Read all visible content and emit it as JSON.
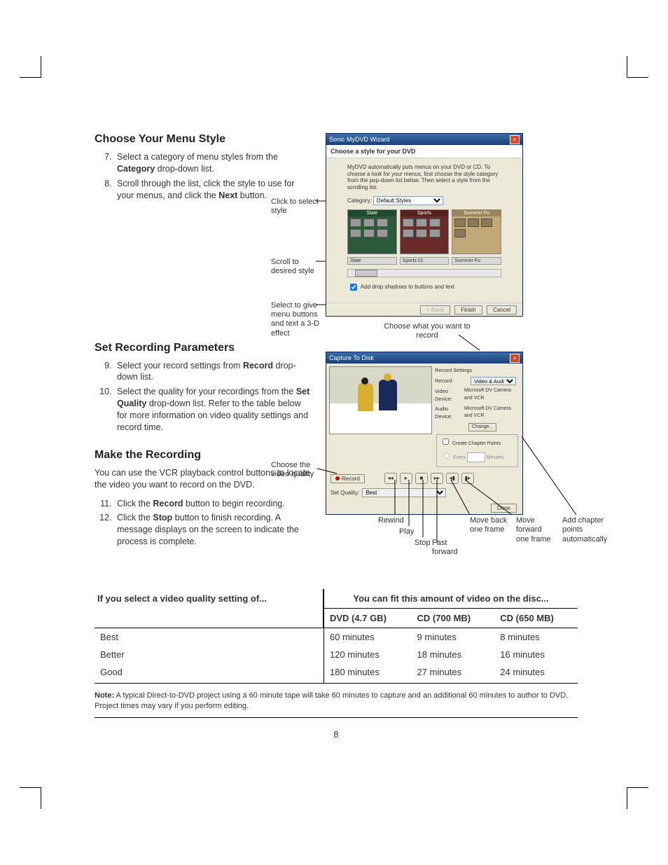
{
  "sections": {
    "choose_menu": {
      "heading": "Choose Your Menu Style",
      "step7_a": "Select a category of menu styles from the ",
      "step7_bold": "Category",
      "step7_b": " drop-down list.",
      "step8_a": "Scroll through the list, click the style to use for your menus, and click the ",
      "step8_bold": "Next",
      "step8_b": " button."
    },
    "set_rec": {
      "heading": "Set Recording Parameters",
      "step9_a": "Select your record settings from ",
      "step9_bold": "Record",
      "step9_b": " drop-down list.",
      "step10_a": "Select the quality for your recordings from the ",
      "step10_bold": "Set Quality",
      "step10_b": " drop-down list. Refer to the table below for more information on video quality settings and record time."
    },
    "make_rec": {
      "heading": "Make the Recording",
      "intro": "You can use the VCR playback control buttons to locate the video you want to record on the DVD.",
      "step11_a": "Click the ",
      "step11_bold": "Record",
      "step11_b": " button to begin recording.",
      "step12_a": "Click the ",
      "step12_bold": "Stop",
      "step12_b": " button to finish recording. A message displays on the screen to indicate the process is complete."
    }
  },
  "wizard": {
    "title": "Sonic MyDVD Wizard",
    "head": "Choose a style for your DVD",
    "desc": "MyDVD automatically puts menus on your DVD or CD. To choose a look for your menus, first choose the style category from the pop-down list below. Then select a style from the scrolling list.",
    "category_label": "Category:",
    "category_value": "Default Styles",
    "tile1": "Slate",
    "tile2": "Sports",
    "tile3": "Summer Fu",
    "scroll1": "Slate",
    "scroll2": "Sports 01",
    "scroll3": "Summer Fu",
    "checkbox": "Add drop shadows to buttons and text",
    "btn_back": "< Back",
    "btn_finish": "Finish",
    "btn_cancel": "Cancel"
  },
  "capture": {
    "title": "Capture To Disk",
    "record_settings": "Record Settings",
    "record_label": "Record:",
    "record_value": "Video & Audio",
    "video_device_label": "Video Device:",
    "video_device_value": "Microsoft DV Camera and VCR",
    "audio_device_label": "Audio Device:",
    "audio_device_value": "Microsoft DV Camera and VCR",
    "change": "Change...",
    "chapter_box": "Create Chapter Points",
    "every": "Every",
    "minutes": "Minutes",
    "record_btn": "Record",
    "set_quality_label": "Set Quality:",
    "set_quality_value": "Best",
    "done": "Done",
    "glyph_rewind": "◂◂",
    "glyph_play": "▸",
    "glyph_stop": "■",
    "glyph_ff": "▸▸",
    "glyph_stepback": "◂▮",
    "glyph_stepfwd": "▮▸"
  },
  "annotations": {
    "click_select": "Click to select style",
    "scroll_desired": "Scroll to desired style",
    "select_3d": "Select to give menu buttons and text a 3-D effect",
    "choose_record": "Choose what you want to record",
    "choose_quality": "Choose the video quality",
    "rewind": "Rewind",
    "play": "Play",
    "stop": "Stop",
    "fast_forward": "Fast forward",
    "move_back": "Move back one frame",
    "move_fwd": "Move forward one frame",
    "add_chapter": "Add chapter points automatically"
  },
  "table": {
    "subhead": "You can fit this amount of video on the disc...",
    "left_head": "If you select a video quality setting of...",
    "col_dvd": "DVD (4.7 GB)",
    "col_cd700": "CD (700 MB)",
    "col_cd650": "CD (650 MB)",
    "rows": [
      {
        "q": "Best",
        "dvd": "60 minutes",
        "cd700": "9 minutes",
        "cd650": "8 minutes"
      },
      {
        "q": "Better",
        "dvd": "120 minutes",
        "cd700": "18 minutes",
        "cd650": "16 minutes"
      },
      {
        "q": "Good",
        "dvd": "180 minutes",
        "cd700": "27 minutes",
        "cd650": "24 minutes"
      }
    ]
  },
  "note_bold": "Note:",
  "note_text": " A typical Direct-to-DVD project using a 60 minute tape will take 60 minutes to capture and an additional 60 minutes to author to DVD. Project times may vary if you perform editing.",
  "page_number": "8"
}
